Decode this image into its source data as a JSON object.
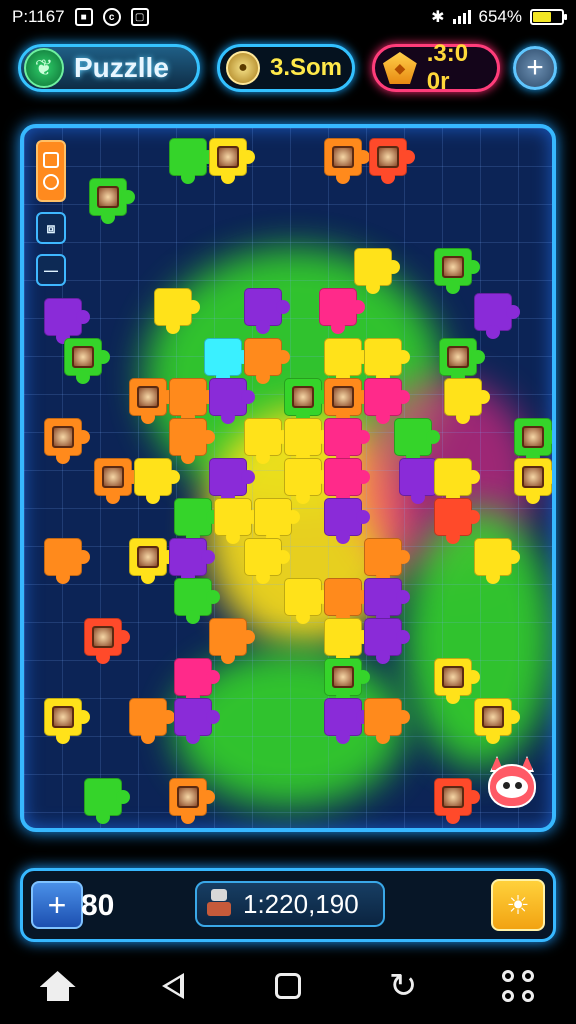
{
  "status_bar": {
    "time": "P:1167",
    "battery_text": "654%",
    "battery_level": 0.65
  },
  "header": {
    "title": "Puzzlle",
    "coins": "3.Som",
    "gems": ".3:0 0r",
    "add_label": "+"
  },
  "board": {
    "side_tools": [
      "",
      "⧈",
      "—"
    ],
    "colors": {
      "background": "#0c2456",
      "border": "#37b8ff",
      "green": "#35d42a",
      "yellow": "#ffe21a",
      "orange": "#ff8a1c",
      "purple": "#8a2bd8",
      "magenta": "#ff2a8a",
      "red": "#ff4a2a"
    }
  },
  "bottom_bar": {
    "plus_label": "+",
    "moves": "80",
    "score": "1:220,190",
    "hint_icon": "☀"
  },
  "nav": {
    "items": [
      "home-icon",
      "back-icon",
      "recent-apps-icon",
      "refresh-icon",
      "grid-menu-icon"
    ]
  }
}
